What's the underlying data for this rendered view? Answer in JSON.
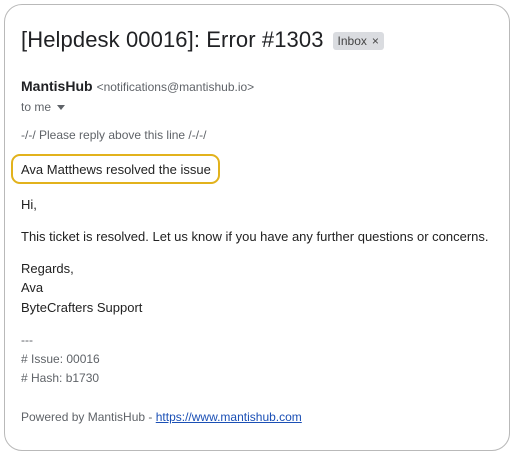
{
  "email": {
    "subject": "[Helpdesk 00016]: Error #1303",
    "label": "Inbox",
    "label_close": "×",
    "sender_name": "MantisHub",
    "sender_email": "<notifications@mantishub.io>",
    "to": "to me",
    "reply_marker": "-/-/ Please reply above this line /-/-/",
    "resolved_line": "Ava Matthews resolved the issue",
    "greeting": "Hi,",
    "message": "This ticket is resolved. Let us know if you have any further questions or concerns.",
    "signoff": "Regards,",
    "signer_name": "Ava",
    "signer_team": "ByteCrafters Support",
    "separator": "---",
    "issue_line": "# Issue: 00016",
    "hash_line": "# Hash: b1730",
    "footer_prefix": "Powered by MantisHub -",
    "footer_link": "https://www.mantishub.com"
  },
  "colors": {
    "highlight": "#e2b21c",
    "link": "#1a4fb5"
  },
  "icons": {
    "expand": "caret-down"
  }
}
